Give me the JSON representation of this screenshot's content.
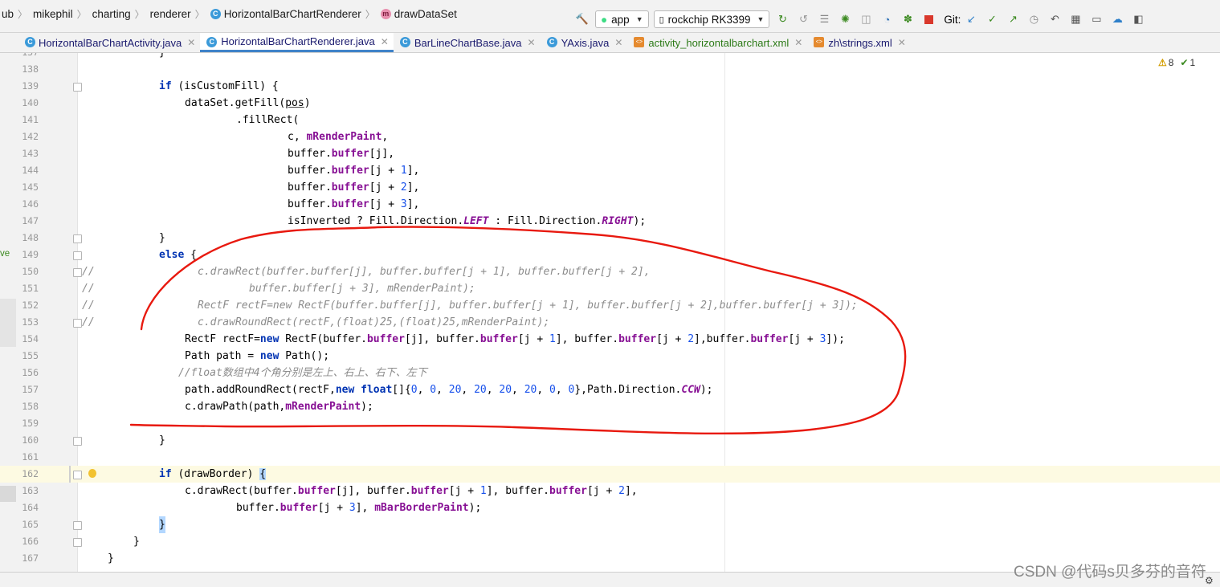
{
  "breadcrumb": {
    "items": [
      "ub",
      "mikephil",
      "charting",
      "renderer",
      "HorizontalBarChartRenderer",
      "drawDataSet"
    ]
  },
  "toolbar": {
    "run_config": "app",
    "device": "rockchip RK3399",
    "git_label": "Git:"
  },
  "tabs": [
    {
      "label": "HorizontalBarChartActivity.java",
      "icon": "class-icon"
    },
    {
      "label": "HorizontalBarChartRenderer.java",
      "icon": "class-icon",
      "active": true
    },
    {
      "label": "BarLineChartBase.java",
      "icon": "class-icon"
    },
    {
      "label": "YAxis.java",
      "icon": "class-icon"
    },
    {
      "label": "activity_horizontalbarchart.xml",
      "icon": "xml-icon"
    },
    {
      "label": "zh\\strings.xml",
      "icon": "xml-icon"
    }
  ],
  "inspections": {
    "warnings": "8",
    "weak_warnings": "1"
  },
  "gutter_clip": "ve",
  "lines": [
    {
      "n": "137"
    },
    {
      "n": "138"
    },
    {
      "n": "139"
    },
    {
      "n": "140"
    },
    {
      "n": "141"
    },
    {
      "n": "142"
    },
    {
      "n": "143"
    },
    {
      "n": "144"
    },
    {
      "n": "145"
    },
    {
      "n": "146"
    },
    {
      "n": "147"
    },
    {
      "n": "148"
    },
    {
      "n": "149"
    },
    {
      "n": "150"
    },
    {
      "n": "151"
    },
    {
      "n": "152"
    },
    {
      "n": "153"
    },
    {
      "n": "154"
    },
    {
      "n": "155"
    },
    {
      "n": "156"
    },
    {
      "n": "157"
    },
    {
      "n": "158"
    },
    {
      "n": "159"
    },
    {
      "n": "160"
    },
    {
      "n": "161"
    },
    {
      "n": "162"
    },
    {
      "n": "163"
    },
    {
      "n": "164"
    },
    {
      "n": "165"
    },
    {
      "n": "166"
    },
    {
      "n": "167"
    }
  ],
  "code": {
    "l137": "}",
    "l139": [
      "if",
      " (isCustomFill) {"
    ],
    "l140": [
      "dataSet.getFill(",
      "pos",
      ")"
    ],
    "l141": ".fillRect(",
    "l142": [
      "c, ",
      "mRenderPaint",
      ","
    ],
    "l143": [
      "buffer.",
      "buffer",
      "[j],"
    ],
    "l144": [
      "buffer.",
      "buffer",
      "[j + ",
      "1",
      "],"
    ],
    "l145": [
      "buffer.",
      "buffer",
      "[j + ",
      "2",
      "],"
    ],
    "l146": [
      "buffer.",
      "buffer",
      "[j + ",
      "3",
      "],"
    ],
    "l147": [
      "isInverted ? Fill.Direction.",
      "LEFT",
      " : Fill.Direction.",
      "RIGHT",
      ");"
    ],
    "l148": "}",
    "l149": [
      "else",
      " {"
    ],
    "l150_marker": "//",
    "l150": "c.drawRect(buffer.buffer[j], buffer.buffer[j + 1], buffer.buffer[j + 2],",
    "l151_marker": "//",
    "l151": "buffer.buffer[j + 3], mRenderPaint);",
    "l152_marker": "//",
    "l152": "RectF rectF=new RectF(buffer.buffer[j], buffer.buffer[j + 1], buffer.buffer[j + 2],buffer.buffer[j + 3]);",
    "l153_marker": "//",
    "l153": "c.drawRoundRect(rectF,(float)25,(float)25,mRenderPaint);",
    "l154": [
      "RectF rectF=",
      "new",
      " RectF(buffer.",
      "buffer",
      "[j], buffer.",
      "buffer",
      "[j + ",
      "1",
      "], buffer.",
      "buffer",
      "[j + ",
      "2",
      "],buffer.",
      "buffer",
      "[j + ",
      "3",
      "]);"
    ],
    "l155": [
      "Path path = ",
      "new",
      " Path();"
    ],
    "l156": "//float数组中4个角分别是左上、右上、右下、左下",
    "l157": [
      "path.addRoundRect(rectF,",
      "new",
      " ",
      "float",
      "[]{",
      "0",
      ", ",
      "0",
      ", ",
      "20",
      ", ",
      "20",
      ", ",
      "20",
      ", ",
      "20",
      ", ",
      "0",
      ", ",
      "0",
      "},Path.Direction.",
      "CCW",
      ");"
    ],
    "l158": [
      "c.drawPath(path,",
      "mRenderPaint",
      ");"
    ],
    "l160": "}",
    "l162": [
      "if",
      " (drawBorder) ",
      "{"
    ],
    "l163": [
      "c.drawRect(buffer.",
      "buffer",
      "[j], buffer.",
      "buffer",
      "[j + ",
      "1",
      "], buffer.",
      "buffer",
      "[j + ",
      "2",
      "],"
    ],
    "l164": [
      "buffer.",
      "buffer",
      "[j + ",
      "3",
      "], ",
      "mBarBorderPaint",
      ");"
    ],
    "l165": "}",
    "l166": "}",
    "l167": "}"
  },
  "watermark": "CSDN @代码s贝多芬的音符",
  "colors": {
    "keyword": "#0033b3",
    "field": "#871094",
    "number": "#1750eb",
    "comment": "#8c8c8c",
    "annotation_loop": "#e8190f"
  }
}
